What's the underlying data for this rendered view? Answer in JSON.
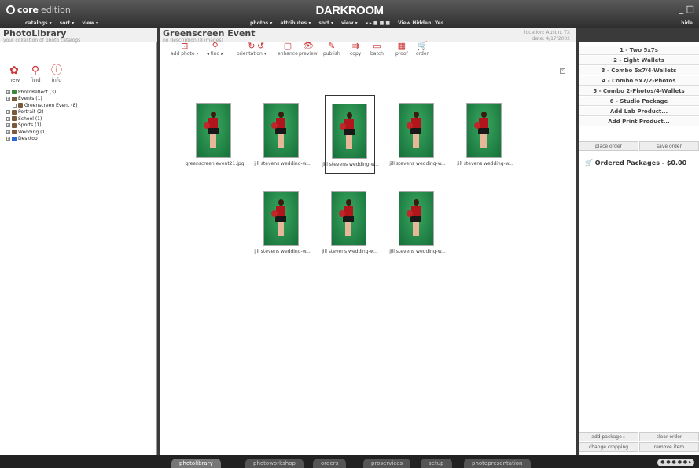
{
  "app": {
    "edition_bold": "core",
    "edition_light": "edition",
    "brand": "DARKROOM",
    "window_controls": "_ □"
  },
  "menubar": {
    "left": [
      "catalogs ▾",
      "sort ▾",
      "view ▾"
    ],
    "mid": [
      "photos ▾",
      "attributes ▾",
      "sort ▾",
      "view ▾",
      "◂ ▸ ■ ■ ■",
      "View Hidden: Yes"
    ],
    "right": "hide"
  },
  "library": {
    "title": "PhotoLibrary",
    "subtitle": "your collection of photo catalogs",
    "tools": [
      {
        "label": "new",
        "icon": "new-icon"
      },
      {
        "label": "find",
        "icon": "search-icon"
      },
      {
        "label": "info",
        "icon": "info-icon"
      }
    ],
    "tree": [
      {
        "label": "PhotoReflect (3)",
        "indent": 0,
        "color": "#3a8a3a"
      },
      {
        "label": "Events (1)",
        "indent": 0,
        "color": "#7a5a3a"
      },
      {
        "label": "Greenscreen Event (8)",
        "indent": 1,
        "color": "#7a5a3a"
      },
      {
        "label": "Portrait (2)",
        "indent": 0,
        "color": "#7a5a3a"
      },
      {
        "label": "School (1)",
        "indent": 0,
        "color": "#7a5a3a"
      },
      {
        "label": "Sports (1)",
        "indent": 0,
        "color": "#7a5a3a"
      },
      {
        "label": "Wedding (1)",
        "indent": 0,
        "color": "#7a5a3a"
      },
      {
        "label": "Desktop",
        "indent": 0,
        "color": "#2a6ad0"
      }
    ]
  },
  "event": {
    "title": "Greenscreen Event",
    "subtitle": "no description (8 images)",
    "location": "location: Austin, TX",
    "date": "date: 4/17/2002",
    "tools": [
      {
        "label": "add photo ▾",
        "icon": "add-photo-icon"
      },
      {
        "label": "◂ find ▸",
        "icon": "find-icon"
      },
      {
        "label": "orientation ▾",
        "icon": "rotate-icon"
      },
      {
        "label": "",
        "icon": "rotate-ccw-icon"
      },
      {
        "label": "enhance",
        "icon": "enhance-icon"
      },
      {
        "label": "preview",
        "icon": "preview-icon"
      },
      {
        "label": "publish",
        "icon": "publish-icon"
      },
      {
        "label": "copy",
        "icon": "copy-icon"
      },
      {
        "label": "batch",
        "icon": "batch-icon"
      },
      {
        "label": "proof",
        "icon": "proof-icon"
      },
      {
        "label": "order",
        "icon": "cart-icon"
      }
    ],
    "photos": [
      {
        "caption": "greenscreen event21.jpg",
        "selected": false
      },
      {
        "caption": "jill stevens wedding-w...",
        "selected": false
      },
      {
        "caption": "jill stevens wedding-w...",
        "selected": true
      },
      {
        "caption": "jill stevens wedding-w...",
        "selected": false
      },
      {
        "caption": "jill stevens wedding-w...",
        "selected": false
      },
      {
        "caption": "jill stevens wedding-w...",
        "selected": false
      },
      {
        "caption": "jill stevens wedding-w...",
        "selected": false
      },
      {
        "caption": "jill stevens wedding-w...",
        "selected": false
      }
    ]
  },
  "order": {
    "packages": [
      "1 - Two 5x7s",
      "2 - Eight Wallets",
      "3 - Combo 5x7/4-Wallets",
      "4 - Combo 5x7/2-Photos",
      "5 - Combo 2-Photos/4-Wallets",
      "6 - Studio Package",
      "Add Lab Product...",
      "Add Print Product..."
    ],
    "place_order": "place order",
    "save_order": "save order",
    "ordered_label": "Ordered Packages - $0.00",
    "add_package": "add package ▸",
    "clear_order": "clear order",
    "change_cropping": "change cropping",
    "remove_item": "remove item"
  },
  "footer": {
    "tabs": [
      "photolibrary",
      "photoworkshop",
      "orders",
      "proservices",
      "setup",
      "photopresentation"
    ],
    "pager": "● ● ● ● ● ▸"
  }
}
